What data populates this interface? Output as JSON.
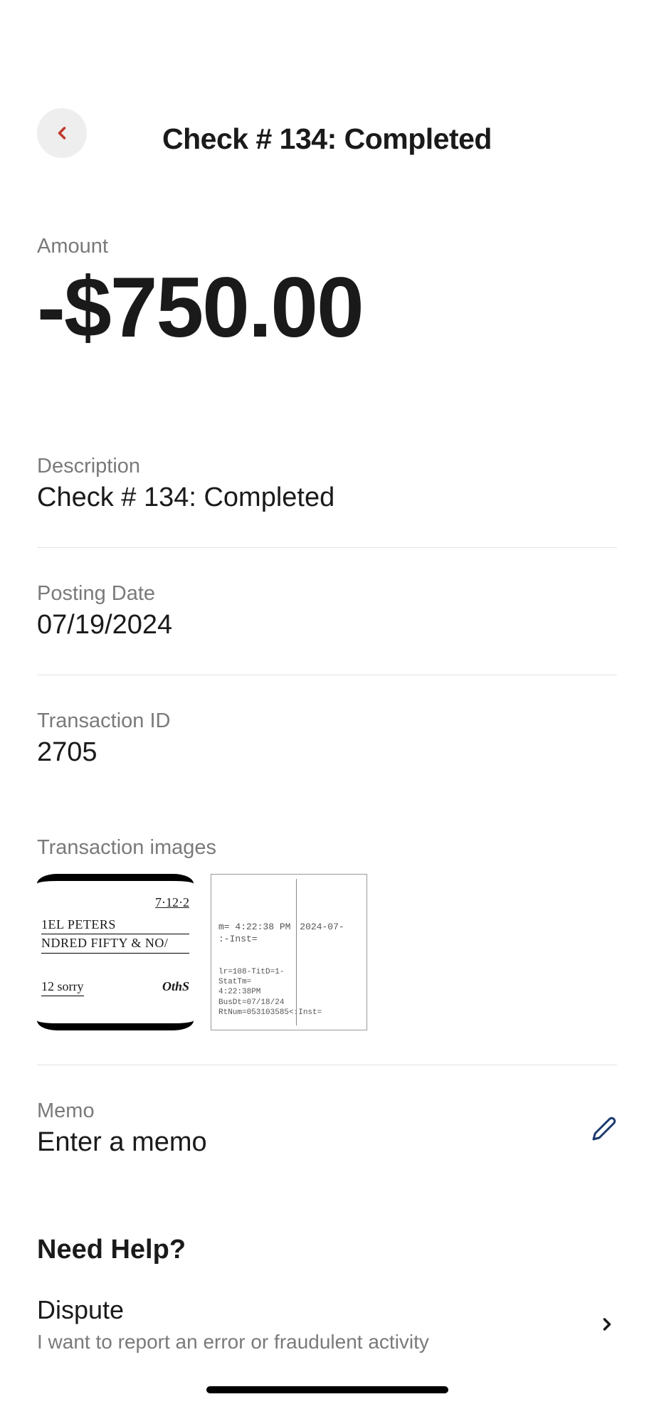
{
  "header": {
    "title": "Check # 134: Completed"
  },
  "amount": {
    "label": "Amount",
    "value": "-$750.00"
  },
  "description": {
    "label": "Description",
    "value": "Check # 134: Completed"
  },
  "posting_date": {
    "label": "Posting Date",
    "value": "07/19/2024"
  },
  "transaction_id": {
    "label": "Transaction ID",
    "value": "2705"
  },
  "images": {
    "label": "Transaction images",
    "front": {
      "date": "7·12·2",
      "payee": "1EL PETERS",
      "amount_words": "NDRED FIFTY & NO/",
      "memo": "12 sorry",
      "sig": "OthS"
    },
    "back": {
      "time": "m= 4:22:38 PM",
      "inst": ":-Inst=",
      "line1": "lr=108-TitD=1-StatTm= 4:22:38PM",
      "line2": "BusDt=07/18/24",
      "line3": "RtNum=053103585<:Inst=",
      "date": "2024-07-"
    }
  },
  "memo": {
    "label": "Memo",
    "placeholder": "Enter a memo"
  },
  "help": {
    "title": "Need Help?",
    "dispute": {
      "title": "Dispute",
      "subtitle": "I want to report an error or fraudulent activity"
    }
  }
}
